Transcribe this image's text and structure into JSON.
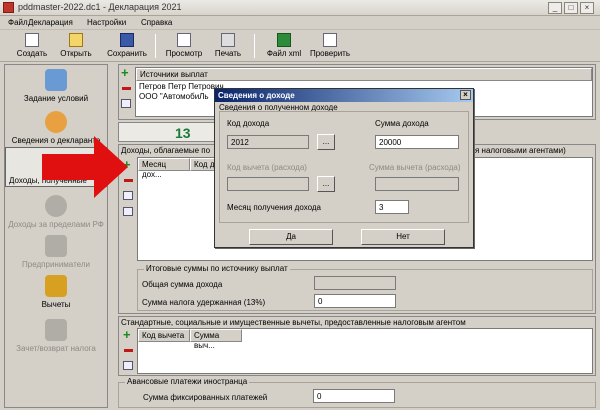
{
  "window": {
    "title": "pddmaster-2022.dc1 - Декларация 2021"
  },
  "menu": [
    "Файл",
    "Декларация",
    "Настройки",
    "Справка"
  ],
  "toolbar": {
    "create": "Создать",
    "open": "Открыть",
    "save": "Сохранить",
    "preview": "Просмотр",
    "print": "Печать",
    "xml": "Файл xml",
    "check": "Проверить"
  },
  "sidebar": {
    "conditions": "Задание условий",
    "declarant": "Сведения о декларанте",
    "income_rf": "Доходы, полученные",
    "income_abroad": "Доходы за пределами РФ",
    "entrepreneurs": "Предприниматели",
    "deductions": "Вычеты",
    "tax_offset": "Зачет/возврат налога"
  },
  "sources": {
    "header": "Источники выплат",
    "rows": [
      "Петров Петр Петрович",
      "ООО \"АвтомобиЛь"
    ]
  },
  "step_number": "13",
  "income_panel": {
    "title": "Доходы, облагаемые по",
    "title_right": "я налоговыми агентами)",
    "col_month": "Месяц дох...",
    "col_code": "Код д"
  },
  "totals": {
    "legend": "Итоговые суммы по источнику выплат",
    "total_income_label": "Общая сумма дохода",
    "total_income_value": "",
    "tax_withheld_label": "Сумма налога удержанная (13%)",
    "tax_withheld_value": "0"
  },
  "deductions_panel": {
    "legend": "Стандартные, социальные и имущественные вычеты, предоставленные налоговым агентом",
    "col_code": "Код вычета",
    "col_sum": "Сумма выч..."
  },
  "advance": {
    "legend": "Авансовые платежи иностранца",
    "label": "Сумма фиксированных платежей",
    "value": "0"
  },
  "dialog": {
    "title": "Сведения о доходе",
    "group": "Сведения о полученном доходе",
    "income_code_label": "Код дохода",
    "income_code_value": "2012",
    "income_sum_label": "Сумма дохода",
    "income_sum_value": "20000",
    "deduction_code_label": "Код вычета (расхода)",
    "deduction_sum_label": "Сумма вычета (расхода)",
    "month_label": "Месяц получения дохода",
    "month_value": "3",
    "ok": "Да",
    "cancel": "Нет",
    "browse": "..."
  }
}
